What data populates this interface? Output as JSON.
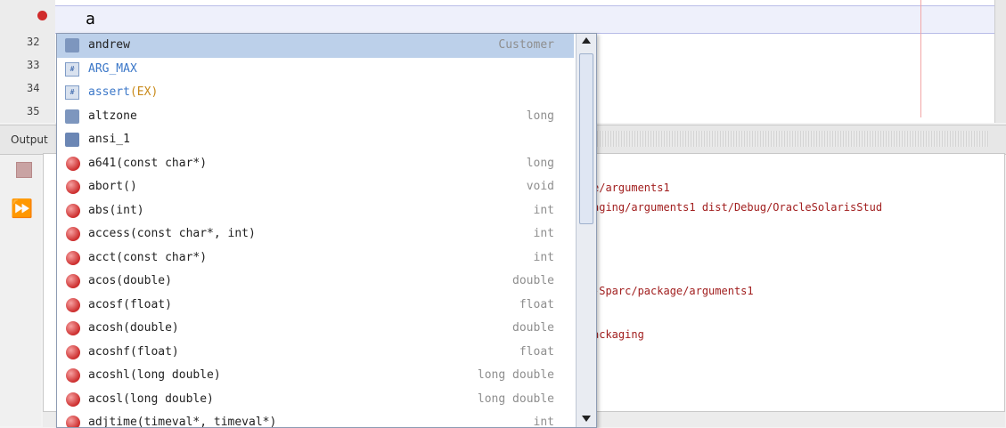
{
  "editor": {
    "typed_text": "a",
    "line_numbers": [
      "32",
      "33",
      "34",
      "35"
    ]
  },
  "output": {
    "label": "Output",
    "lines": [
      "e/arguments1",
      "aging/arguments1 dist/Debug/OracleSolarisStud",
      "-Sparc/package/arguments1",
      "ackaging"
    ]
  },
  "completion": {
    "items": [
      {
        "name": "andrew",
        "type": "Customer",
        "icon": "variable-icon",
        "style": "normal"
      },
      {
        "name": "ARG_MAX",
        "type": "",
        "icon": "macro-icon",
        "style": "blue"
      },
      {
        "name": "assert(EX)",
        "type": "",
        "icon": "macro-icon",
        "style": "blue-param"
      },
      {
        "name": "altzone",
        "type": "long",
        "icon": "variable-icon",
        "style": "normal"
      },
      {
        "name": "ansi_1",
        "type": "",
        "icon": "global-variable-icon",
        "style": "normal"
      },
      {
        "name": "a641(const char*)",
        "type": "long",
        "icon": "function-icon",
        "style": "normal"
      },
      {
        "name": "abort()",
        "type": "void",
        "icon": "function-icon",
        "style": "normal"
      },
      {
        "name": "abs(int)",
        "type": "int",
        "icon": "function-icon",
        "style": "normal"
      },
      {
        "name": "access(const char*, int)",
        "type": "int",
        "icon": "function-icon",
        "style": "normal"
      },
      {
        "name": "acct(const char*)",
        "type": "int",
        "icon": "function-icon",
        "style": "normal"
      },
      {
        "name": "acos(double)",
        "type": "double",
        "icon": "function-icon",
        "style": "normal"
      },
      {
        "name": "acosf(float)",
        "type": "float",
        "icon": "function-icon",
        "style": "normal"
      },
      {
        "name": "acosh(double)",
        "type": "double",
        "icon": "function-icon",
        "style": "normal"
      },
      {
        "name": "acoshf(float)",
        "type": "float",
        "icon": "function-icon",
        "style": "normal"
      },
      {
        "name": "acoshl(long double)",
        "type": "long double",
        "icon": "function-icon",
        "style": "normal"
      },
      {
        "name": "acosl(long double)",
        "type": "long double",
        "icon": "function-icon",
        "style": "normal"
      },
      {
        "name": "adjtime(timeval*, timeval*)",
        "type": "int",
        "icon": "function-icon",
        "style": "normal"
      }
    ]
  }
}
